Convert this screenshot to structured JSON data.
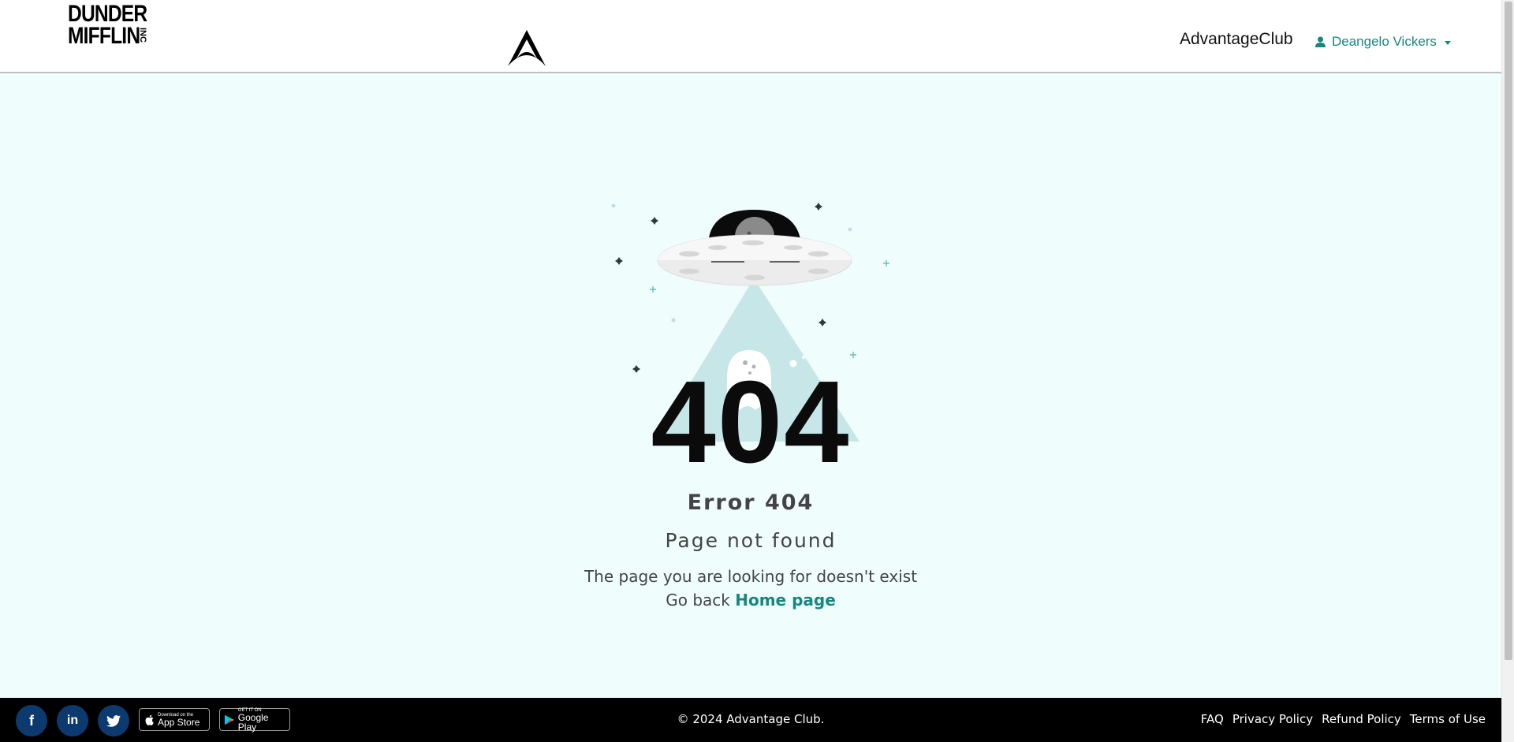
{
  "header": {
    "company_logo": {
      "line1": "DUNDER",
      "line2": "MIFFLIN",
      "suffix": "INC"
    },
    "center_logo_icon": "advantage-a-logo-icon",
    "club_title": "AdvantageClub",
    "user": {
      "name": "Deangelo Vickers",
      "icon": "user-icon"
    }
  },
  "main": {
    "illustration_icon": "ufo-ghost-illustration",
    "code": "404",
    "title": "Error 404",
    "subtitle": "Page not found",
    "description": "The page you are looking for doesn't exist",
    "back_prefix": "Go back",
    "back_link": "Home page"
  },
  "footer": {
    "social": [
      {
        "name": "facebook",
        "glyph": "f"
      },
      {
        "name": "linkedin",
        "glyph": "in"
      },
      {
        "name": "twitter",
        "glyph": ""
      }
    ],
    "app_store": {
      "small": "Download on the",
      "big": "App Store"
    },
    "google_play": {
      "small": "GET IT ON",
      "big": "Google Play"
    },
    "copyright": "© 2024 Advantage Club.",
    "links": [
      "FAQ",
      "Privacy Policy",
      "Refund Policy",
      "Terms of Use"
    ]
  },
  "colors": {
    "accent": "#17867f",
    "background": "#f0fdfd",
    "footer_bg": "#000000",
    "social_bg": "#0d3a6e"
  }
}
